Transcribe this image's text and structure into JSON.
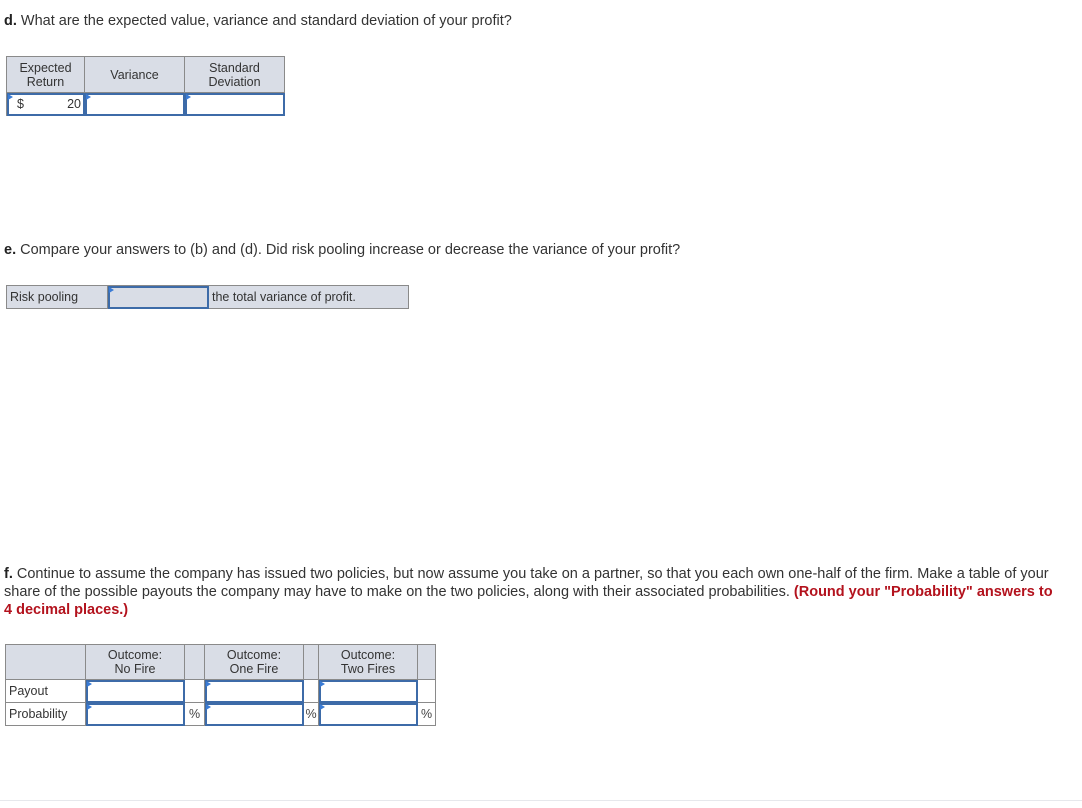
{
  "part_d": {
    "letter": "d.",
    "question": " What are the expected value, variance and standard deviation of your profit?",
    "table": {
      "headers": [
        "Expected Return",
        "Variance",
        "Standard Deviation"
      ],
      "header_lines": [
        [
          "Expected",
          "Return"
        ],
        [
          "Variance"
        ],
        [
          "Standard",
          "Deviation"
        ]
      ],
      "expected_return": {
        "currency": "$",
        "value": "20"
      },
      "variance": {
        "value": ""
      },
      "standard_deviation": {
        "value": ""
      }
    }
  },
  "part_e": {
    "letter": "e.",
    "question": " Compare your answers to (b) and (d). Did risk pooling increase or decrease the variance of your profit?",
    "prefix_label": "Risk pooling",
    "dropdown_value": "",
    "suffix_label": "the total variance of profit."
  },
  "part_f": {
    "letter": "f.",
    "question": " Continue to assume the company has issued two policies, but now assume you take on a partner, so that you each own one-half of the firm. Make a table of your share of the possible payouts the company may have to make on the two policies, along with their associated probabilities.",
    "instruction": "(Round your \"Probability\" answers to 4 decimal places.)",
    "table": {
      "columns": [
        {
          "line1": "Outcome:",
          "line2": "No Fire"
        },
        {
          "line1": "Outcome:",
          "line2": "One Fire"
        },
        {
          "line1": "Outcome:",
          "line2": "Two Fires"
        }
      ],
      "rows": [
        {
          "label": "Payout",
          "values": [
            "",
            "",
            ""
          ],
          "unit": ""
        },
        {
          "label": "Probability",
          "values": [
            "",
            "",
            ""
          ],
          "unit": "%"
        }
      ]
    }
  },
  "colors": {
    "header_bg": "#d9dde6",
    "input_border": "#3d6ba8",
    "input_marker": "#3a7bd5",
    "instruction_red": "#b3121d"
  }
}
